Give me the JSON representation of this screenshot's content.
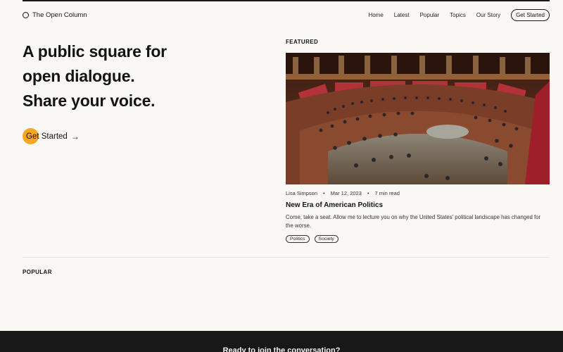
{
  "nav": {
    "brand": "The Open Column",
    "links": [
      "Home",
      "Latest",
      "Popular",
      "Topics",
      "Our Story"
    ],
    "cta": "Get Started"
  },
  "hero": {
    "lines": [
      "A public square for",
      "open dialogue.",
      "Share your voice."
    ],
    "cta_label": "Get Started",
    "cta_arrow": "→",
    "accent_color": "#f5a623"
  },
  "featured": {
    "section_label": "FEATURED",
    "image_icon": "parliament-chamber-photo",
    "author": "Lisa Simpson",
    "date": "Mar 12, 2023",
    "read_time": "7 min read",
    "separator": "•",
    "title": "New Era of American Politics",
    "description": "Come, take a seat. Allow me to lecture you on why the United States' political landscape has changed for the worse.",
    "tags": [
      "Politics",
      "Society"
    ]
  },
  "popular": {
    "section_label": "POPULAR"
  },
  "footer": {
    "heading": "Ready to join the conversation?"
  }
}
